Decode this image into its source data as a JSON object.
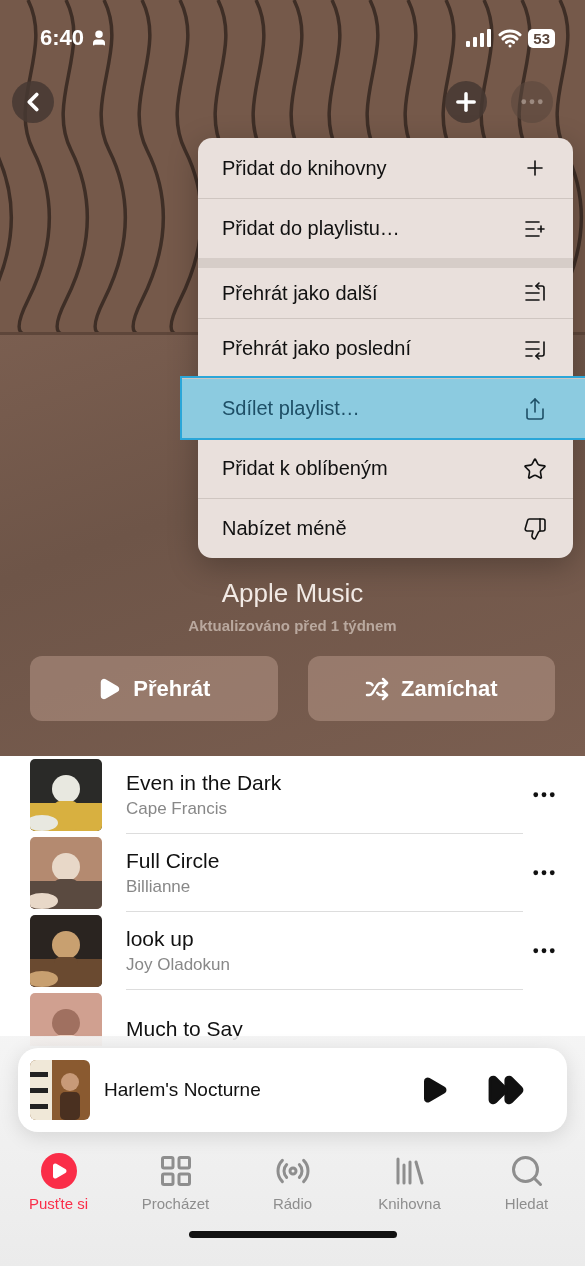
{
  "status_bar": {
    "time": "6:40",
    "battery": "53"
  },
  "menu": {
    "items": [
      {
        "label": "Přidat do knihovny",
        "selected": false
      },
      {
        "label": "Přidat do playlistu…",
        "selected": false
      },
      {
        "label": "Přehrát jako další",
        "selected": false
      },
      {
        "label": "Přehrát jako poslední",
        "selected": false
      },
      {
        "label": "Sdílet playlist…",
        "selected": true
      },
      {
        "label": "Přidat k oblíbeným",
        "selected": false
      },
      {
        "label": "Nabízet méně",
        "selected": false
      }
    ]
  },
  "playlist": {
    "title": "Apple Music",
    "updated": "Aktualizováno před 1 týdnem",
    "buttons": [
      "Přehrát",
      "Zamíchat"
    ]
  },
  "songs": [
    {
      "title": "Even in the Dark",
      "artist": "Cape Francis"
    },
    {
      "title": "Full Circle",
      "artist": "Billianne"
    },
    {
      "title": "look up",
      "artist": "Joy Oladokun"
    },
    {
      "title": "Much to Say"
    }
  ],
  "now_playing": {
    "title": "Harlem's Nocturne"
  },
  "tabs": [
    {
      "label": "Pusťte si",
      "selected": true
    },
    {
      "label": "Procházet",
      "selected": false
    },
    {
      "label": "Rádio",
      "selected": false
    },
    {
      "label": "Knihovna",
      "selected": false
    },
    {
      "label": "Hledat",
      "selected": false
    }
  ]
}
